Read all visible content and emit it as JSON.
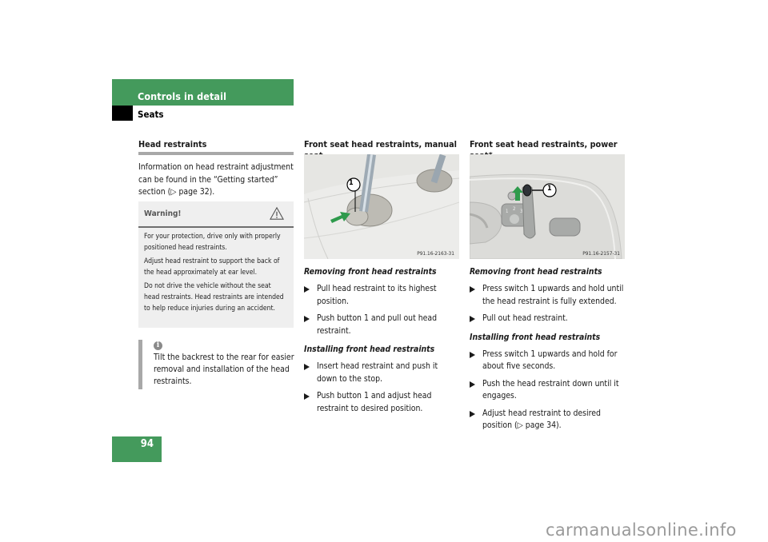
{
  "header": {
    "chapter": "Controls in detail",
    "section": "Seats",
    "accent_color": "#449a5c"
  },
  "page": {
    "number": "94"
  },
  "col1": {
    "heading": "Head restraints",
    "intro": "Information on head restraint adjustment can be found in the “Getting started” section (▷ page 32).",
    "warning": {
      "title": "Warning!",
      "icon": "warning-triangle-icon",
      "paragraphs": [
        "For your protection, drive only with properly positioned head restraints.",
        "Adjust head restraint to support the back of the head approximately at ear level.",
        "Do not drive the vehicle without the seat head restraints. Head restraints are intended to help reduce injuries during an accident."
      ]
    },
    "info": {
      "icon": "info-icon",
      "text": "Tilt the backrest to the rear for easier removal and installation of the head restraints."
    }
  },
  "col2": {
    "heading": "Front seat head restraints, manual seat",
    "figure": {
      "callout": "1",
      "code": "P91.16-2163-31"
    },
    "removing": {
      "title": "Removing front head restraints",
      "steps": [
        "Pull head restraint to its highest position.",
        "Push button 1 and pull out head restraint."
      ]
    },
    "installing": {
      "title": "Installing front head restraints",
      "steps": [
        "Insert head restraint and push it down to the stop.",
        "Push button 1 and adjust head restraint to desired position."
      ]
    }
  },
  "col3": {
    "heading": "Front seat head restraints, power seat*",
    "figure": {
      "callout": "1",
      "code": "P91.16-2157-31"
    },
    "removing": {
      "title": "Removing front head restraints",
      "steps": [
        "Press switch 1 upwards and hold until the head restraint is fully extended.",
        "Pull out head restraint."
      ]
    },
    "installing": {
      "title": "Installing front head restraints",
      "steps": [
        "Press switch 1 upwards and hold for about five seconds.",
        "Push the head restraint down until it engages.",
        "Adjust head restraint to desired position (▷ page 34)."
      ]
    }
  },
  "watermark": "carmanualsonline.info"
}
